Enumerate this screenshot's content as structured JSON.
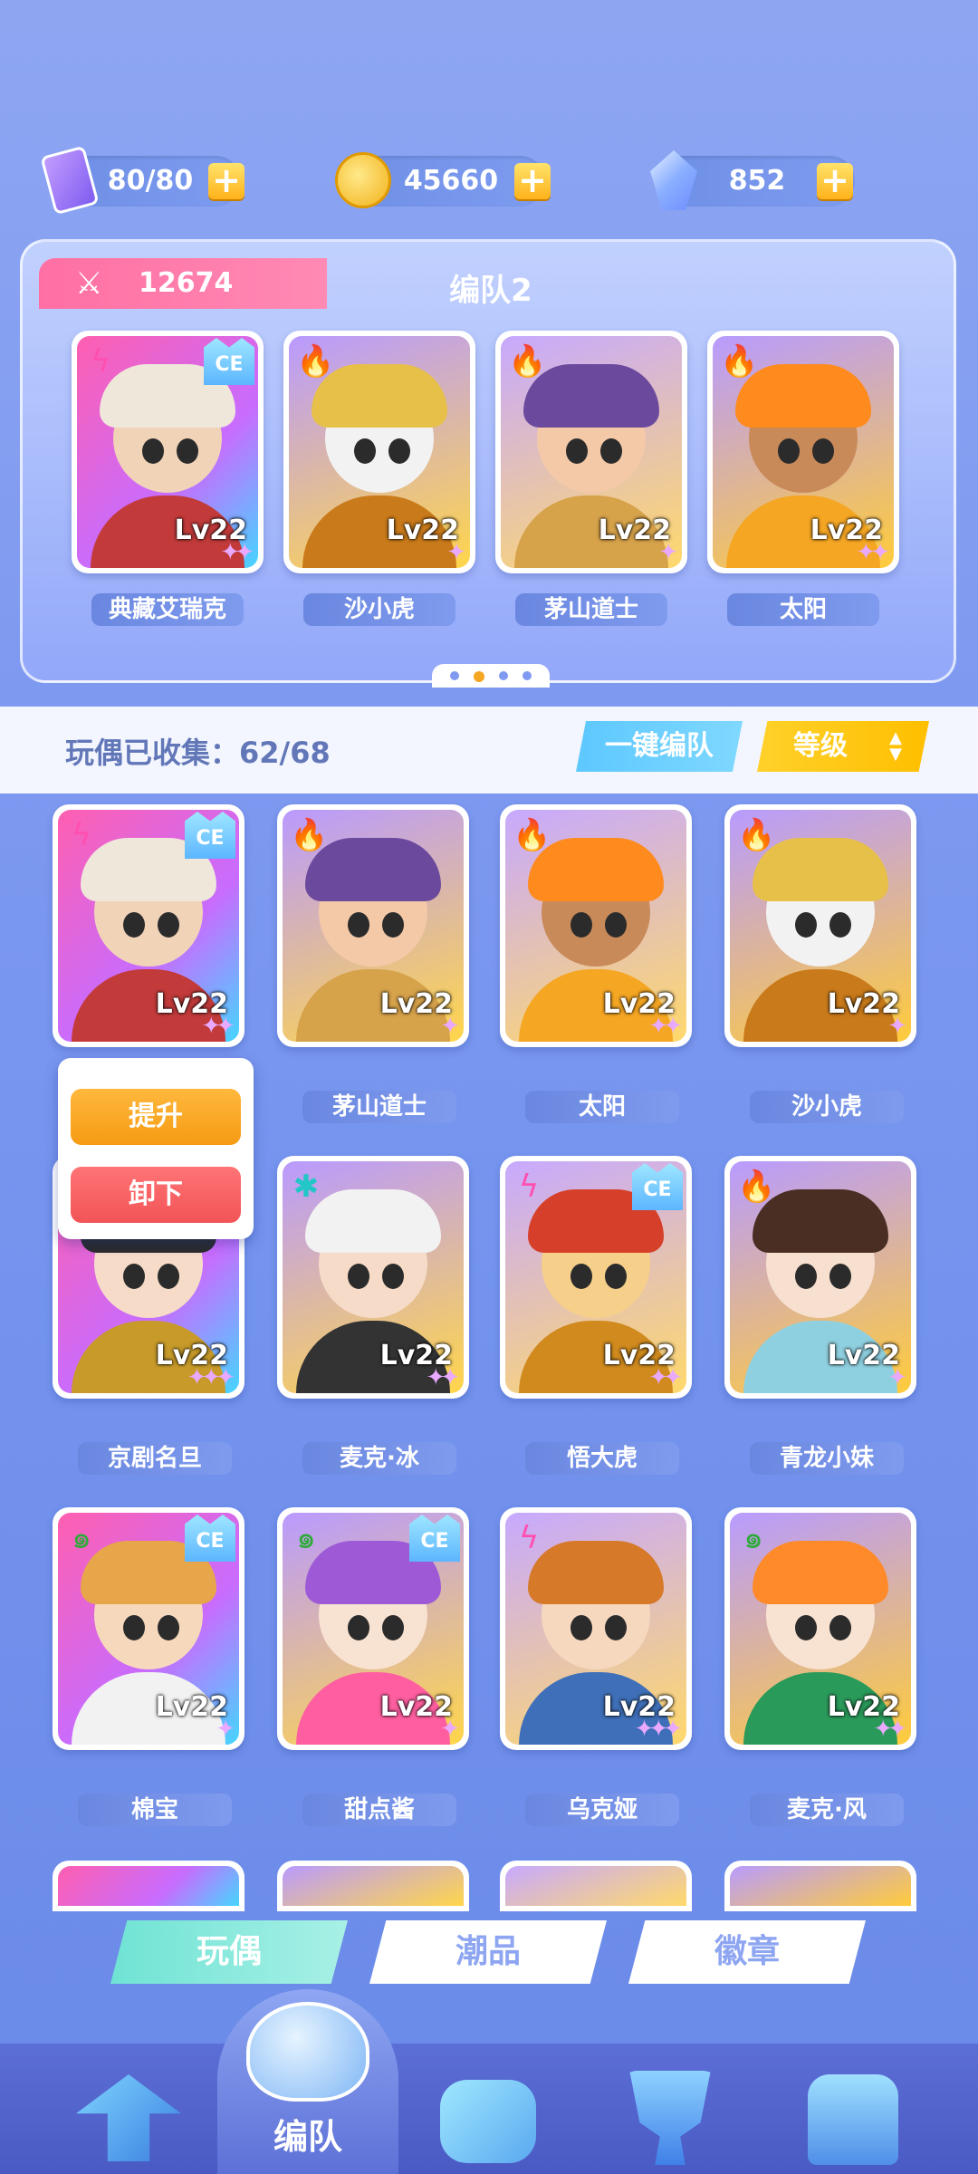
{
  "resources": {
    "stamina": {
      "value": "80/80",
      "icon": "energy-ticket-icon"
    },
    "coins": {
      "value": "45660",
      "icon": "coin-icon"
    },
    "gems": {
      "value": "852",
      "icon": "crystal-icon"
    },
    "plus_icon": "plus-icon"
  },
  "team_panel": {
    "power": "12674",
    "power_icon": "crossed-swords-icon",
    "title": "编队2",
    "members": [
      {
        "name": "典藏艾瑞克",
        "level": "Lv22",
        "element": "lightning",
        "ce": true,
        "stars": 2
      },
      {
        "name": "沙小虎",
        "level": "Lv22",
        "element": "fire",
        "ce": false,
        "stars": 1
      },
      {
        "name": "茅山道士",
        "level": "Lv22",
        "element": "fire",
        "ce": false,
        "stars": 1
      },
      {
        "name": "太阳",
        "level": "Lv22",
        "element": "fire",
        "ce": false,
        "stars": 2
      }
    ],
    "page_dots": 4,
    "active_page": 2
  },
  "collection": {
    "label": "玩偶已收集：62/68",
    "auto_team_button": "一键编队",
    "sort_button": "等级"
  },
  "popup": {
    "upgrade": "提升",
    "unequip": "卸下"
  },
  "grid": [
    {
      "name": "",
      "level": "Lv22",
      "element": "lightning",
      "ce": true,
      "stars": 2
    },
    {
      "name": "茅山道士",
      "level": "Lv22",
      "element": "fire",
      "ce": false,
      "stars": 1
    },
    {
      "name": "太阳",
      "level": "Lv22",
      "element": "fire",
      "ce": false,
      "stars": 2
    },
    {
      "name": "沙小虎",
      "level": "Lv22",
      "element": "fire",
      "ce": false,
      "stars": 1
    },
    {
      "name": "京剧名旦",
      "level": "Lv22",
      "element": "",
      "ce": false,
      "stars": 3
    },
    {
      "name": "麦克·冰",
      "level": "Lv22",
      "element": "ice",
      "ce": false,
      "stars": 2
    },
    {
      "name": "悟大虎",
      "level": "Lv22",
      "element": "lightning",
      "ce": true,
      "stars": 2
    },
    {
      "name": "青龙小妹",
      "level": "Lv22",
      "element": "fire",
      "ce": false,
      "stars": 1
    },
    {
      "name": "棉宝",
      "level": "Lv22",
      "element": "wind",
      "ce": true,
      "stars": 1
    },
    {
      "name": "甜点酱",
      "level": "Lv22",
      "element": "wind",
      "ce": true,
      "stars": 1
    },
    {
      "name": "乌克娅",
      "level": "Lv22",
      "element": "lightning",
      "ce": false,
      "stars": 3
    },
    {
      "name": "麦克·风",
      "level": "Lv22",
      "element": "wind",
      "ce": false,
      "stars": 2
    }
  ],
  "category_tabs": [
    {
      "label": "玩偶",
      "active": true
    },
    {
      "label": "潮品",
      "active": false
    },
    {
      "label": "徽章",
      "active": false
    }
  ],
  "bottom_nav": {
    "active_label": "编队",
    "items": [
      "upgrade-arrow-icon",
      "whistle-team-icon",
      "puzzle-icon",
      "trophy-icon",
      "slot-machine-icon"
    ]
  },
  "colors": {
    "background": "#7f9af0",
    "accent_pink": "#ff6fa3",
    "accent_yellow": "#ffc107",
    "accent_cyan": "#5dc8ff",
    "upgrade_orange": "#f59b13",
    "unequip_red": "#f25456"
  }
}
